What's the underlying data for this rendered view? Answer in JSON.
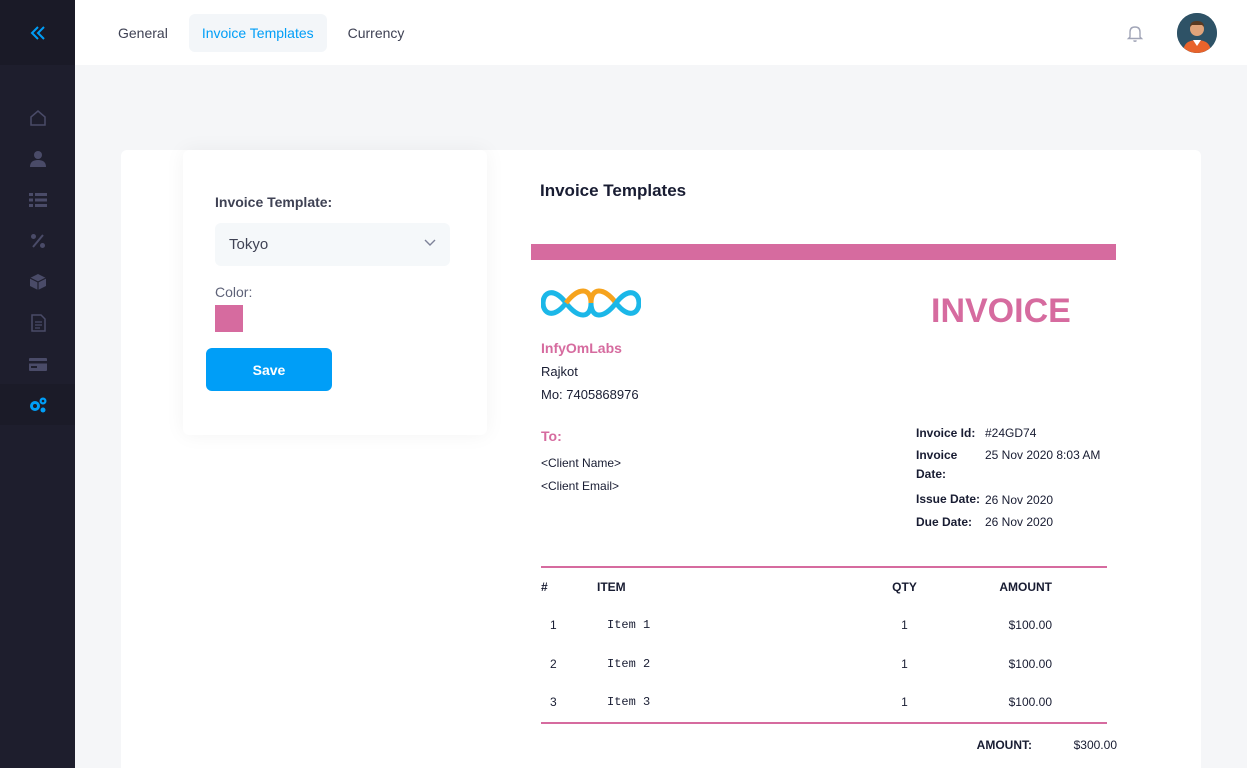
{
  "sidebar": {
    "toggle_icon": "double-chevron-left-icon",
    "items": [
      {
        "icon": "home-icon"
      },
      {
        "icon": "user-icon"
      },
      {
        "icon": "list-icon"
      },
      {
        "icon": "percent-icon"
      },
      {
        "icon": "box-icon"
      },
      {
        "icon": "document-icon"
      },
      {
        "icon": "card-icon"
      },
      {
        "icon": "settings-icon",
        "active": true
      }
    ]
  },
  "header": {
    "tabs": [
      {
        "label": "General"
      },
      {
        "label": "Invoice Templates",
        "active": true
      },
      {
        "label": "Currency"
      }
    ],
    "bell_icon": "bell-icon"
  },
  "settings": {
    "template_label": "Invoice Template:",
    "template_value": "Tokyo",
    "color_label": "Color:",
    "color_value": "#d66b9f",
    "save_label": "Save"
  },
  "preview": {
    "title": "Invoice Templates",
    "company": "InfyOmLabs",
    "city": "Rajkot",
    "mobile": "Mo: 7405868976",
    "invoice_title": "INVOICE",
    "to_label": "To:",
    "client_name": "<Client Name>",
    "client_email": "<Client Email>",
    "meta": {
      "id_label": "Invoice Id:",
      "id_value": "#24GD74",
      "date_label": "Invoice Date:",
      "date_value": "25 Nov 2020 8:03 AM",
      "issue_label": "Issue Date:",
      "issue_value": "26 Nov 2020",
      "due_label": "Due Date:",
      "due_value": "26 Nov 2020"
    },
    "columns": {
      "num": "#",
      "item": "ITEM",
      "qty": "QTY",
      "amount": "AMOUNT"
    },
    "rows": [
      {
        "num": "1",
        "item": "Item 1",
        "qty": "1",
        "amount": "$100.00"
      },
      {
        "num": "2",
        "item": "Item 2",
        "qty": "1",
        "amount": "$100.00"
      },
      {
        "num": "3",
        "item": "Item 3",
        "qty": "1",
        "amount": "$100.00"
      }
    ],
    "total_label": "AMOUNT:",
    "total_value": "$300.00"
  },
  "colors": {
    "accent": "#009ef7",
    "template_color": "#d66b9f",
    "sidebar_bg": "#1e1e2d"
  }
}
